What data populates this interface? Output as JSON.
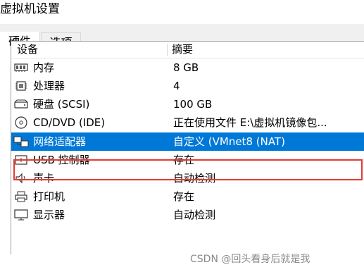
{
  "window": {
    "title": "虚拟机设置"
  },
  "tabs": [
    {
      "label": "硬件",
      "active": true
    },
    {
      "label": "选项",
      "active": false
    }
  ],
  "list": {
    "headers": {
      "device": "设备",
      "summary": "摘要"
    },
    "rows": [
      {
        "icon": "memory-icon",
        "device": "内存",
        "summary": "8 GB"
      },
      {
        "icon": "processor-icon",
        "device": "处理器",
        "summary": "4"
      },
      {
        "icon": "hard-disk-icon",
        "device": "硬盘 (SCSI)",
        "summary": "100 GB"
      },
      {
        "icon": "cd-dvd-icon",
        "device": "CD/DVD (IDE)",
        "summary": "正在使用文件 E:\\虚拟机镜像包..."
      },
      {
        "icon": "network-adapter-icon",
        "device": "网络适配器",
        "summary": "自定义 (VMnet8 (NAT)",
        "selected": true
      },
      {
        "icon": "usb-icon",
        "device": "USB 控制器",
        "summary": "存在"
      },
      {
        "icon": "speaker-icon",
        "device": "声卡",
        "summary": "自动检测"
      },
      {
        "icon": "printer-icon",
        "device": "打印机",
        "summary": "存在"
      },
      {
        "icon": "monitor-icon",
        "device": "显示器",
        "summary": "自动检测"
      }
    ]
  },
  "watermark": "CSDN @回头看身后就是我",
  "colors": {
    "selection": "#0078d7",
    "highlight_border": "#e53935"
  }
}
